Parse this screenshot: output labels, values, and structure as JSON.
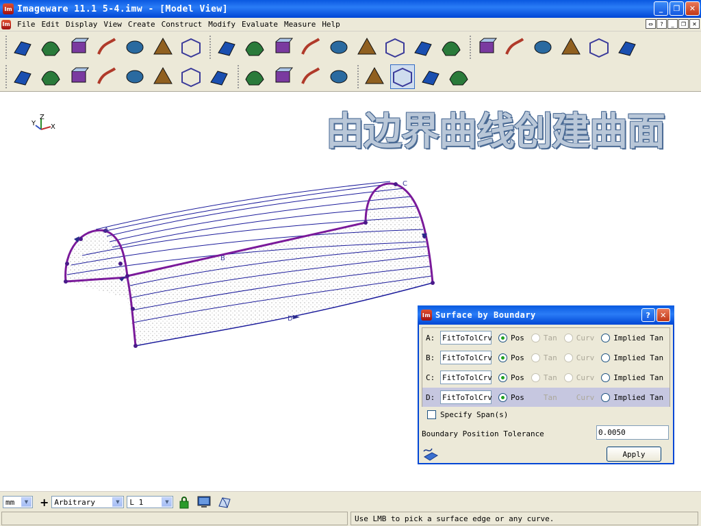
{
  "window": {
    "title": "Imageware 11.1    5-4.imw - [Model View]",
    "controls": [
      "minimize-icon",
      "restore-icon",
      "close-icon"
    ]
  },
  "menu": {
    "items": [
      "File",
      "Edit",
      "Display",
      "View",
      "Create",
      "Construct",
      "Modify",
      "Evaluate",
      "Measure",
      "Help"
    ]
  },
  "toolbar": {
    "row1_icons": [
      "open-file-icon",
      "import-icon",
      "zoom-part-icon",
      "plane-icon",
      "box-icon",
      "primitive-shapes-icon",
      "bowl-surface-icon",
      "surface-from-curves-icon",
      "offset-surface-icon",
      "blend-surface-icon",
      "fillet-surface-icon",
      "loft-surface-icon",
      "extrude-surface-icon",
      "sweep-surface-icon",
      "revolve-surface-icon",
      "cone-icon",
      "wireframe-box-icon",
      "glasses-icon",
      "network-icon",
      "cylinder-icon",
      "plane-cross-icon",
      "axis-icon"
    ],
    "row2_icons": [
      "curve-surface-icon",
      "twist-surface-icon",
      "layers-surface-icon",
      "normal-arrow-icon",
      "ring-surface-icon",
      "grid-box-icon",
      "sphere-tool-icon",
      "cut-surface-icon",
      "paint-surface-icon",
      "stripes-surface-icon",
      "ribs-surface-icon",
      "color-map-icon",
      "palette-icon",
      "surface-by-boundary-icon",
      "curve-icon",
      "flat-surface-icon"
    ]
  },
  "viewport": {
    "overlay_title": "由边界曲线创建曲面",
    "triad": {
      "x": "X",
      "y": "Y",
      "z": "Z"
    },
    "curve_labels": [
      "A",
      "B",
      "C",
      "D"
    ]
  },
  "dialog": {
    "title": "Surface by Boundary",
    "rows": [
      {
        "label": "A:",
        "value": "FitToTolCrv",
        "options": [
          "Pos",
          "Tan",
          "Curv",
          "Implied Tan"
        ]
      },
      {
        "label": "B:",
        "value": "FitToTolCrv",
        "options": [
          "Pos",
          "Tan",
          "Curv",
          "Implied Tan"
        ]
      },
      {
        "label": "C:",
        "value": "FitToTolCrv",
        "options": [
          "Pos",
          "Tan",
          "Curv",
          "Implied Tan"
        ]
      },
      {
        "label": "D:",
        "value": "FitToTolCrv",
        "options": [
          "Pos",
          "Tan",
          "Curv",
          "Implied Tan"
        ]
      }
    ],
    "specify_span_label": "Specify Span(s)",
    "tolerance_label": "Boundary Position Tolerance",
    "tolerance_value": "0.0050",
    "apply_label": "Apply"
  },
  "statusbar": {
    "units": "mm",
    "plane": "Arbitrary",
    "layer": "L 1",
    "message": "Use LMB to pick a surface edge or any curve."
  }
}
